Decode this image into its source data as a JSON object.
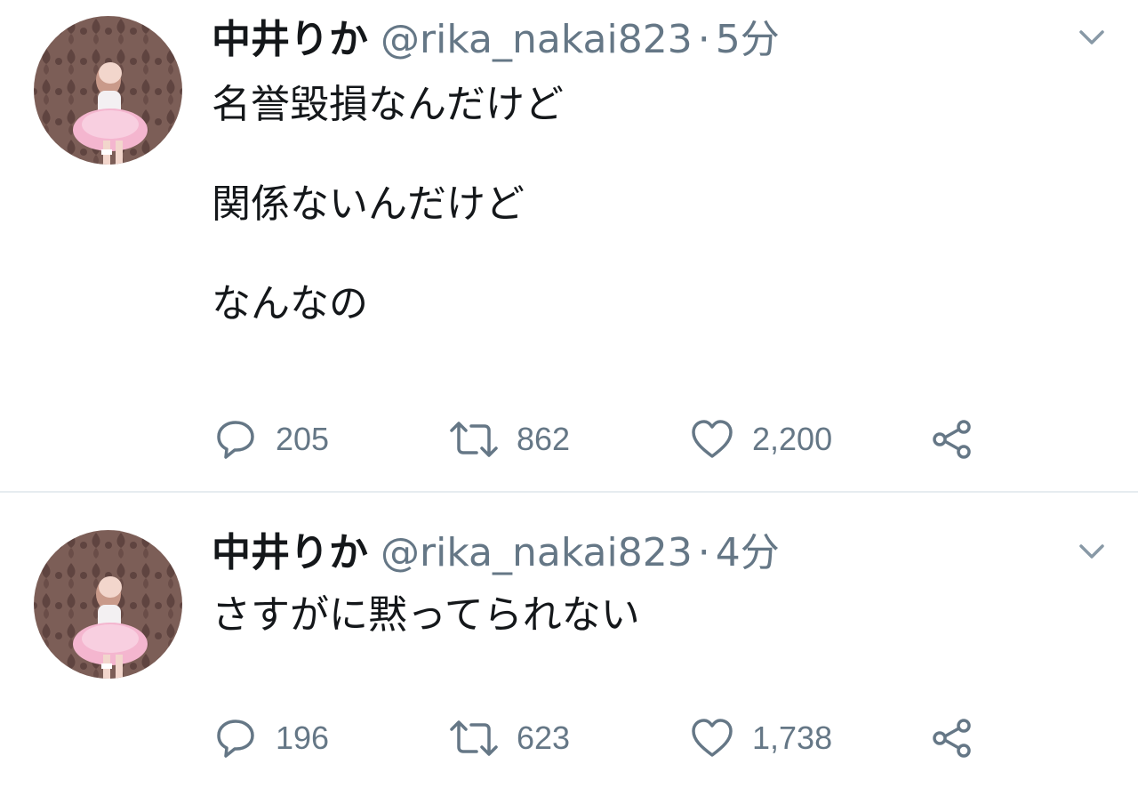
{
  "tweets": [
    {
      "display_name": "中井りか",
      "handle": "@rika_nakai823",
      "separator": "·",
      "time": "5分",
      "text": "名誉毀損なんだけど\n\n関係ないんだけど\n\nなんなの",
      "replies": "205",
      "retweets": "862",
      "likes": "2,200",
      "icons": [
        "avatar-photo",
        "chevron-down-icon",
        "reply-icon",
        "retweet-icon",
        "heart-icon",
        "share-icon"
      ]
    },
    {
      "display_name": "中井りか",
      "handle": "@rika_nakai823",
      "separator": "·",
      "time": "4分",
      "text": "さすがに黙ってられない",
      "replies": "196",
      "retweets": "623",
      "likes": "1,738",
      "icons": [
        "avatar-photo",
        "chevron-down-icon",
        "reply-icon",
        "retweet-icon",
        "heart-icon",
        "share-icon"
      ]
    }
  ],
  "colors": {
    "text": "#14171a",
    "secondary": "#657786",
    "divider": "#e6ecf0"
  }
}
